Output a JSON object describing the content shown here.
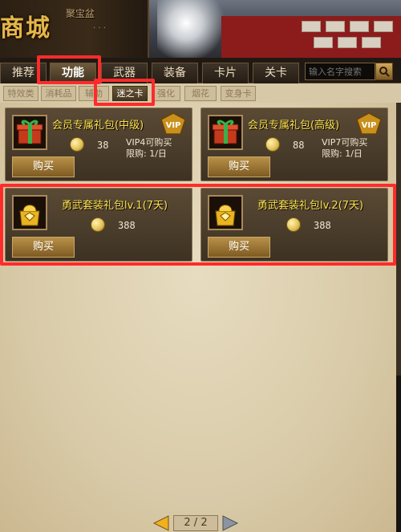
{
  "banner": {
    "title": "商城",
    "sub": "聚宝盆",
    "sub2": "· · ·"
  },
  "tabs": [
    {
      "label": "推荐"
    },
    {
      "label": "功能"
    },
    {
      "label": "武器"
    },
    {
      "label": "装备"
    },
    {
      "label": "卡片"
    },
    {
      "label": "关卡"
    }
  ],
  "active_tab": "功能",
  "search": {
    "placeholder": "输入名字搜索"
  },
  "subtabs": [
    {
      "label": "特效类"
    },
    {
      "label": "消耗品"
    },
    {
      "label": "辅助"
    },
    {
      "label": "迷之卡"
    },
    {
      "label": "强化"
    },
    {
      "label": "烟花"
    },
    {
      "label": "变身卡"
    }
  ],
  "active_subtab": "迷之卡",
  "items": [
    {
      "name": "会员专属礼包(中级)",
      "price": "38",
      "vip_line1": "VIP4可购买",
      "vip_line2": "限购: 1/日",
      "buy": "购买",
      "vip_badge": "VIP",
      "icon": "gift-box-icon"
    },
    {
      "name": "会员专属礼包(高级)",
      "price": "88",
      "vip_line1": "VIP7可购买",
      "vip_line2": "限购: 1/日",
      "buy": "购买",
      "vip_badge": "VIP",
      "icon": "gift-box-icon"
    },
    {
      "name": "勇武套装礼包lv.1(7天)",
      "price": "388",
      "buy": "购买",
      "icon": "golden-bag-icon"
    },
    {
      "name": "勇武套装礼包lv.2(7天)",
      "price": "388",
      "buy": "购买",
      "icon": "golden-bag-icon"
    }
  ],
  "pager": {
    "text": "2 / 2"
  },
  "colors": {
    "highlight": "#ff2b2b",
    "gold_text": "#ffe14d"
  }
}
